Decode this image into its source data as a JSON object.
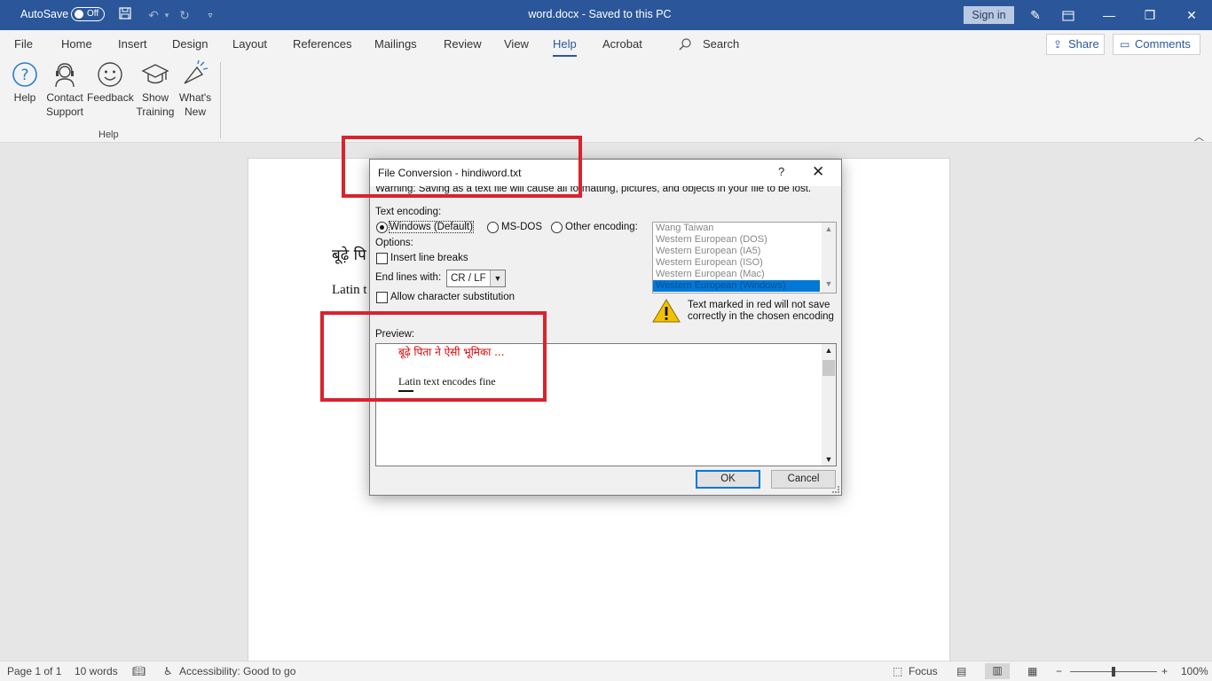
{
  "titlebar": {
    "autosave_label": "AutoSave",
    "autosave_state": "Off",
    "document_title": "word.docx  -  Saved to this PC",
    "signin_label": "Sign in"
  },
  "menu": {
    "tabs": [
      "File",
      "Home",
      "Insert",
      "Design",
      "Layout",
      "References",
      "Mailings",
      "Review",
      "View",
      "Help",
      "Acrobat"
    ],
    "active_tab": "Help",
    "search_label": "Search",
    "share_label": "Share",
    "comments_label": "Comments"
  },
  "ribbon": {
    "buttons": [
      {
        "line1": "Help",
        "line2": ""
      },
      {
        "line1": "Contact",
        "line2": "Support"
      },
      {
        "line1": "Feedback",
        "line2": ""
      },
      {
        "line1": "Show",
        "line2": "Training"
      },
      {
        "line1": "What's",
        "line2": "New"
      }
    ],
    "group_label": "Help"
  },
  "document": {
    "line1": "बूढ़े पि",
    "line2": "Latin t"
  },
  "dialog": {
    "title": "File Conversion - hindiword.txt",
    "help_glyph": "?",
    "close_glyph": "✕",
    "warning": "Warning: Saving as a text file will cause all formatting, pictures, and objects in your file to be lost.",
    "text_encoding_label": "Text encoding:",
    "radio_windows": "Windows (Default)",
    "radio_msdos": "MS-DOS",
    "radio_other": "Other encoding:",
    "options_label": "Options:",
    "insert_line_breaks": "Insert line breaks",
    "end_lines_label": "End lines with:",
    "end_lines_value": "CR / LF",
    "allow_substitution": "Allow character substitution",
    "encodings": [
      "Wang Taiwan",
      "Western European (DOS)",
      "Western European (IA5)",
      "Western European (ISO)",
      "Western European (Mac)",
      "Western European (Windows)"
    ],
    "selected_encoding": "Western European (Windows)",
    "red_warning": "Text marked in red will not save correctly in the chosen encoding",
    "preview_label": "Preview:",
    "preview_red": "बूढ़े पिता ने ऐसी भूमिका ...",
    "preview_black": "Latin text encodes fine",
    "ok_label": "OK",
    "cancel_label": "Cancel"
  },
  "statusbar": {
    "page": "Page 1 of 1",
    "words": "10 words",
    "accessibility": "Accessibility: Good to go",
    "focus": "Focus",
    "zoom_minus": "−",
    "zoom_plus": "+",
    "zoom": "100%"
  },
  "colors": {
    "titlebar": "#2b579a",
    "annotation_red": "#d9232d",
    "preview_red_text": "#e00000",
    "selection_blue": "#0078d7"
  }
}
